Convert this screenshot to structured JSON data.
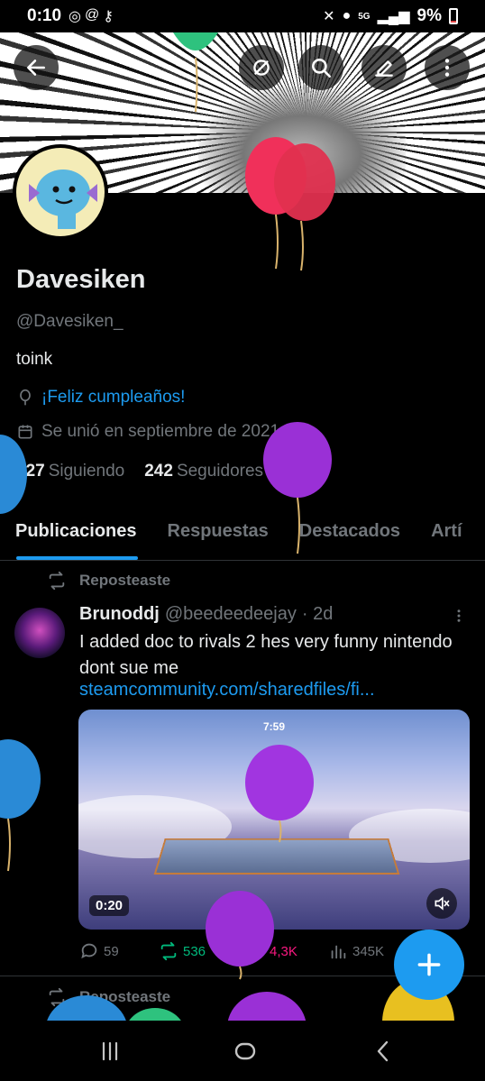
{
  "status_bar": {
    "time": "0:10",
    "network": "5G",
    "battery": "9%"
  },
  "header": {
    "back_icon": "arrow-left-icon",
    "actions": [
      "grok-icon",
      "search-icon",
      "edit-icon",
      "more-vertical-icon"
    ]
  },
  "profile": {
    "name": "Davesiken",
    "handle": "@Davesiken_",
    "bio": "toink",
    "birthday": "¡Feliz cumpleaños!",
    "joined": "Se unió en septiembre de 2021",
    "following_count": "527",
    "following_label": "Siguiendo",
    "followers_count": "242",
    "followers_label": "Seguidores"
  },
  "tabs": [
    {
      "label": "Publicaciones",
      "active": true
    },
    {
      "label": "Respuestas",
      "active": false
    },
    {
      "label": "Destacados",
      "active": false
    },
    {
      "label": "Artí",
      "active": false
    }
  ],
  "post": {
    "repost_label": "Reposteaste",
    "author_name": "Brunoddj",
    "author_handle": "@beedeedeejay",
    "time": "· 2d",
    "text": "I added doc to rivals 2 hes very funny nintendo dont sue me",
    "link": "steamcommunity.com/sharedfiles/fi...",
    "media": {
      "duration": "0:20",
      "timer": "7:59"
    },
    "stats": {
      "replies": "59",
      "reposts": "536",
      "likes": "4,3K",
      "views": "345K"
    }
  },
  "next_post": {
    "repost_label": "Reposteaste"
  },
  "colors": {
    "accent": "#1d9bf0",
    "repost_green": "#00ba7c",
    "like_pink": "#f91880",
    "muted": "#71767b"
  }
}
